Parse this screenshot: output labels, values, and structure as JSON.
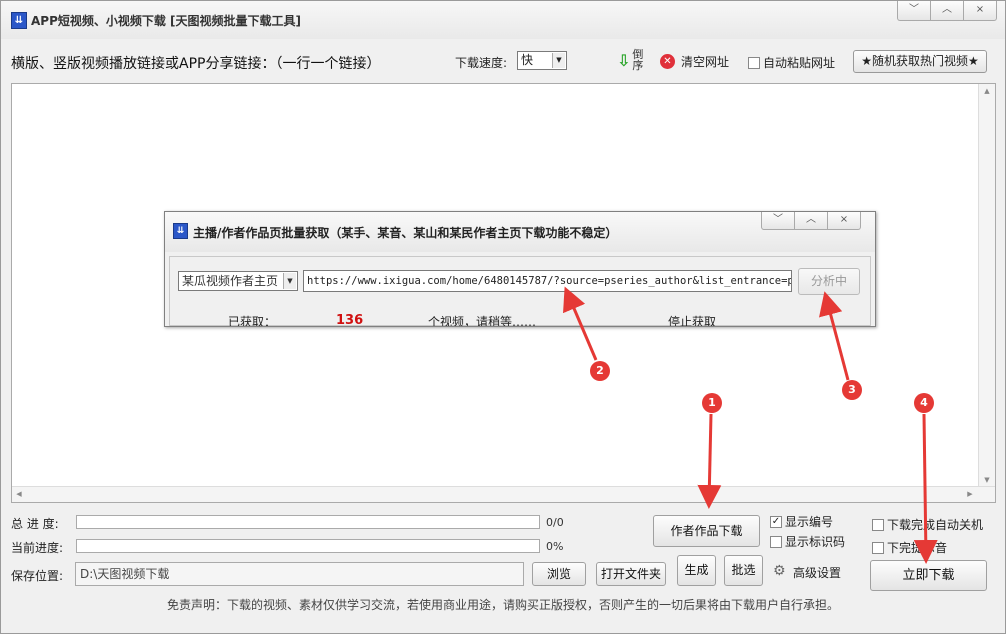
{
  "window": {
    "title": "APP短视频、小视频下载 [天图视频批量下载工具]",
    "controls": [
      "﹀",
      "︿",
      "×"
    ]
  },
  "toolbar": {
    "link_label": "横版、竖版视频播放链接或APP分享链接：（一行一个链接）",
    "speed_label": "下载速度:",
    "speed_value": "快",
    "reverse_label": "倒序",
    "clear_label": "清空网址",
    "autopaste_label": "自动粘贴网址",
    "random_hot_label": "★随机获取热门视频★"
  },
  "dialog": {
    "title": "主播/作者作品页批量获取（某手、某音、某山和某民作者主页下载功能不稳定）",
    "controls": [
      "﹀",
      "︿",
      "×"
    ],
    "platform": "某瓜视频作者主页",
    "url": "https://www.ixigua.com/home/6480145787/?source=pseries_author&list_entrance=pSeri",
    "analyze_label": "分析中",
    "status": {
      "got_label": "已获取：",
      "count": "136",
      "wait_label": "个视频，请稍等……",
      "stop_label": "停止获取"
    }
  },
  "bottom": {
    "total_label": "总 进 度:",
    "total_value": "0/0",
    "total_progress": 0,
    "current_label": "当前进度:",
    "current_value": "0%",
    "current_progress": 0,
    "save_label": "保存位置:",
    "save_path": "D:\\天图视频下载",
    "browse_label": "浏览",
    "open_folder_label": "打开文件夹",
    "author_works_label": "作者作品下载",
    "show_number_label": "显示编号",
    "show_number_checked": true,
    "show_id_label": "显示标识码",
    "show_id_checked": false,
    "generate_label": "生成",
    "pick_label": "批选",
    "advanced_label": "高级设置",
    "auto_shutdown_label": "下载完成自动关机",
    "notify_sound_label": "下完提示音",
    "download_now_label": "立即下载",
    "disclaimer": "免责声明：下载的视频、素材仅供学习交流，若使用商业用途，请购买正版授权，否则产生的一切后果将由下载用户自行承担。"
  },
  "annotations": [
    "1",
    "2",
    "3",
    "4"
  ],
  "colors": {
    "annotation": "#e53935",
    "count": "#d01010",
    "clear_icon": "#e0303a",
    "reverse_arrow": "#2aa52a"
  }
}
